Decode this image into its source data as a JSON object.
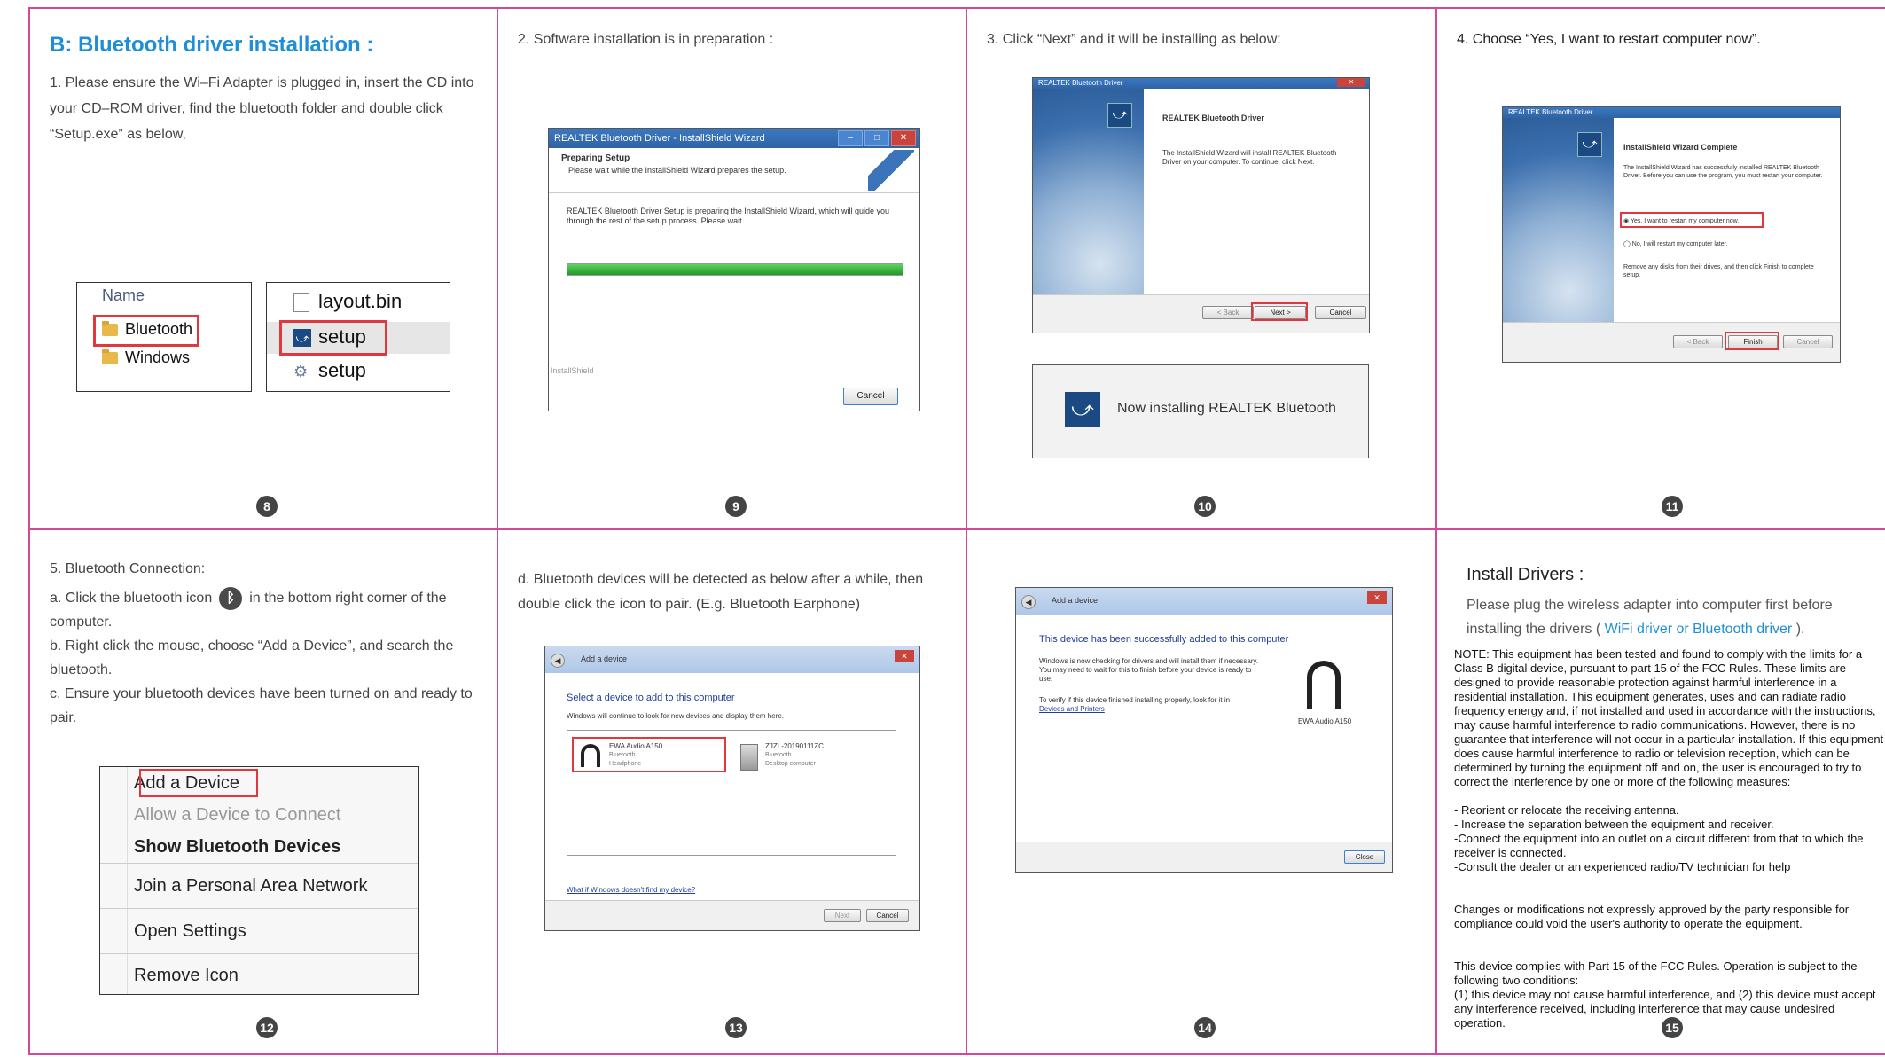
{
  "panel8": {
    "heading": "B: Bluetooth driver installation :",
    "step1": "1. Please ensure the Wi–Fi Adapter is plugged in, insert the CD into your CD–ROM driver, find the bluetooth folder and double click “Setup.exe” as below,",
    "folder_header": "Name",
    "folders": [
      "Bluetooth",
      "Windows"
    ],
    "files": [
      "layout.bin",
      "setup",
      "setup"
    ],
    "page": "8"
  },
  "panel9": {
    "step": "2. Software installation is in preparation :",
    "window_title": "REALTEK Bluetooth Driver - InstallShield Wizard",
    "header_title": "Preparing Setup",
    "header_sub": "Please wait while the InstallShield Wizard prepares the setup.",
    "body": "REALTEK Bluetooth Driver Setup is preparing the InstallShield Wizard, which will guide you through the rest of the setup process. Please wait.",
    "progress": 1.0,
    "footer": "InstallShield",
    "cancel": "Cancel",
    "page": "9"
  },
  "panel10": {
    "step": "3. Click “Next” and it will be installing as below:",
    "window_title": "REALTEK Bluetooth Driver",
    "title": "REALTEK Bluetooth Driver",
    "body": "The InstallShield Wizard will install REALTEK Bluetooth Driver on your computer. To continue, click Next.",
    "back": "< Back",
    "next": "Next >",
    "cancel": "Cancel",
    "installing": "Now installing REALTEK Bluetooth",
    "page": "10"
  },
  "panel11": {
    "step": "4. Choose “Yes, I want to restart computer now”.",
    "window_title": "REALTEK Bluetooth Driver",
    "title": "InstallShield Wizard Complete",
    "body": "The InstallShield Wizard has successfully installed REALTEK Bluetooth Driver. Before you can use the program, you must restart your computer.",
    "option_yes": "Yes, I want to restart my computer now.",
    "option_no": "No, I will restart my computer later.",
    "note": "Remove any disks from their drives, and then click Finish to complete setup.",
    "back": "< Back",
    "finish": "Finish",
    "cancel": "Cancel",
    "page": "11"
  },
  "panel12": {
    "step": "5. Bluetooth Connection:",
    "a_before": "a. Click the bluetooth icon",
    "a_after": "in the bottom right corner of the computer.",
    "b": "b. Right click the mouse, choose “Add a Device”, and search the bluetooth.",
    "c": "c. Ensure your bluetooth devices have been turned on and ready to pair.",
    "menu": [
      "Add a Device",
      "Allow a Device to Connect",
      "Show Bluetooth Devices",
      "Join a Personal Area Network",
      "Open Settings",
      "Remove Icon"
    ],
    "page": "12"
  },
  "panel13": {
    "step": "d. Bluetooth devices will be detected as below after a while, then double click the icon to pair. (E.g. Bluetooth Earphone)",
    "window_title": "Add a device",
    "heading": "Select a device to add to this computer",
    "sub": "Windows will continue to look for new devices and display them here.",
    "device1": {
      "name": "EWA Audio A150",
      "line2": "Bluetooth",
      "line3": "Headphone"
    },
    "device2": {
      "name": "ZJZL-20190111ZC",
      "line2": "Bluetooth",
      "line3": "Desktop computer"
    },
    "help_link": "What if Windows doesn't find my device?",
    "next": "Next",
    "cancel": "Cancel",
    "page": "13"
  },
  "panel14": {
    "window_title": "Add a device",
    "heading": "This device has been successfully added to this computer",
    "body1": "Windows is now checking for drivers and will install them if necessary. You may need to wait for this to finish before your device is ready to use.",
    "body2": "To verify if this device finished installing properly, look for it in",
    "link": "Devices and Printers",
    "device_name": "EWA Audio A150",
    "close": "Close",
    "page": "14"
  },
  "panel15": {
    "heading": "Install Drivers :",
    "intro_before": "Please plug the wireless adapter into computer first before installing the drivers (",
    "intro_link": "WiFi driver or Bluetooth driver",
    "intro_after": ").",
    "note": "NOTE: This equipment has been tested and found to comply with the limits for a Class B digital device, pursuant to part 15 of the FCC Rules. These limits are designed to provide reasonable protection against harmful interference in a residential installation. This equipment generates, uses and can radiate radio frequency energy and, if not installed and used in accordance with the instructions, may cause harmful interference to radio communications. However, there is no guarantee that interference will not occur in a particular installation. If this equipment does cause harmful interference to radio or television reception, which can be determined by turning the equipment off and on, the user is encouraged to try to correct the interference by one or more of the following measures:",
    "measures": [
      "- Reorient or relocate the receiving antenna.",
      "- Increase the separation between the equipment and receiver.",
      "-Connect the equipment into an outlet on a circuit different from that to which the receiver is connected.",
      "-Consult the dealer or an experienced radio/TV technician for help"
    ],
    "changes": "Changes or modifications not expressly approved by the party responsible for compliance could void the user's authority to operate the equipment.",
    "complies": "This device complies with Part 15 of the FCC Rules. Operation is subject to the following two conditions:",
    "conditions": "(1) this device may not cause harmful interference, and (2) this device must accept any interference received, including interference that may cause undesired operation.",
    "page": "15"
  }
}
